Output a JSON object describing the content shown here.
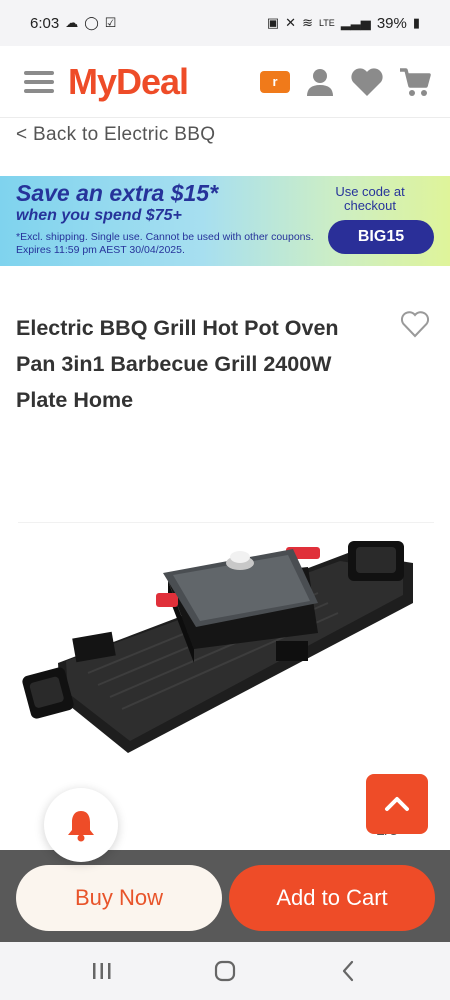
{
  "status_bar": {
    "time": "6:03",
    "battery": "39%",
    "network": "LTE"
  },
  "header": {
    "logo": "MyDeal",
    "rewards_badge": "r"
  },
  "back_link": "< Back to Electric BBQ",
  "promo": {
    "title": "Save an extra $15*",
    "subtitle": "when you spend $75+",
    "fine_print": "*Excl. shipping. Single use. Cannot be used with other coupons. Expires 11:59 pm AEST 30/04/2025.",
    "code_label": "Use code at checkout",
    "code": "BIG15"
  },
  "product": {
    "title": "Electric BBQ Grill Hot Pot Oven Pan 3in1 Barbecue Grill 2400W Plate Home",
    "image_counter": "1/5"
  },
  "actions": {
    "buy_now": "Buy Now",
    "add_to_cart": "Add to Cart"
  },
  "colors": {
    "brand": "#ee4c28",
    "promo_text": "#26339a",
    "promo_button": "#2a2f98"
  },
  "icons": [
    "menu-icon",
    "user-icon",
    "heart-icon",
    "cart-icon",
    "bell-icon",
    "chevron-up-icon",
    "wishlist-heart-icon"
  ]
}
